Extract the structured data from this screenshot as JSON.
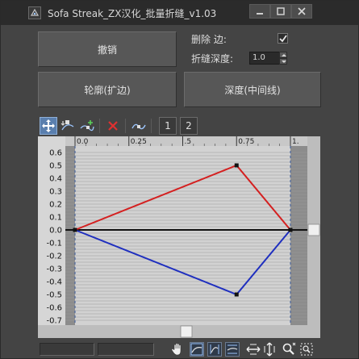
{
  "window": {
    "title": "Sofa Streak_ZX汉化_批量折缝_v1.03"
  },
  "controls": {
    "undo_label": "撤销",
    "delete_edge_label": "删除  边:",
    "delete_edge_checked": true,
    "crease_depth_label": "折缝深度:",
    "crease_depth_value": "1.0",
    "outline_label": "轮廓(扩边)",
    "depth_label": "深度(中间线)"
  },
  "toolbar": {
    "tools": [
      "move-icon",
      "scale-point-icon",
      "add-point-icon",
      "delete-point-icon",
      "reset-curve-icon"
    ],
    "curve1_label": "1",
    "curve2_label": "2"
  },
  "chart_data": {
    "type": "line",
    "x_ticks": [
      "0.0",
      "0.25",
      ".5",
      "0.75",
      "1."
    ],
    "y_ticks": [
      "0.6",
      "0.5",
      "0.4",
      "0.3",
      "0.2",
      "0.1",
      "0.0",
      "-0.1",
      "-0.2",
      "-0.3",
      "-0.4",
      "-0.5",
      "-0.6",
      "-0.7"
    ],
    "xlim": [
      0,
      1
    ],
    "ylim": [
      -0.7,
      0.6
    ],
    "series": [
      {
        "color": "#d42020",
        "x": [
          0,
          0.75,
          1.0
        ],
        "y": [
          0,
          0.5,
          0
        ]
      },
      {
        "color": "#1f2fbf",
        "x": [
          0,
          0.75,
          1.0
        ],
        "y": [
          0,
          -0.5,
          0
        ]
      }
    ],
    "baseline": {
      "color": "#111111",
      "y": 0
    },
    "grid": true,
    "points": [
      {
        "x": 0,
        "y": 0
      },
      {
        "x": 0.75,
        "y": 0.5
      },
      {
        "x": 1.0,
        "y": 0
      },
      {
        "x": 0.75,
        "y": -0.5
      }
    ],
    "horizontal_scroll": 0.5
  },
  "colors": {
    "accent": "#5a7fae",
    "red_curve": "#d42020",
    "blue_curve": "#1f2fbf"
  }
}
